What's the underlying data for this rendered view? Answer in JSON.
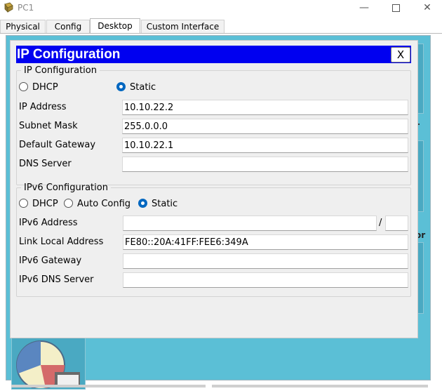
{
  "window": {
    "title": "PC1"
  },
  "tabs": [
    {
      "label": "Physical"
    },
    {
      "label": "Config"
    },
    {
      "label": "Desktop"
    },
    {
      "label": "Custom Interface"
    }
  ],
  "active_tab": "Desktop",
  "desktop": {
    "side_text_1": "r",
    "side_text_2": "or"
  },
  "dialog": {
    "title": "IP Configuration",
    "close_label": "X",
    "ipv4": {
      "legend": "IP Configuration",
      "mode_options": [
        "DHCP",
        "Static"
      ],
      "selected_mode": "Static",
      "fields": [
        {
          "label": "IP Address",
          "value": "10.10.22.2"
        },
        {
          "label": "Subnet Mask",
          "value": "255.0.0.0"
        },
        {
          "label": "Default Gateway",
          "value": "10.10.22.1"
        },
        {
          "label": "DNS Server",
          "value": ""
        }
      ]
    },
    "ipv6": {
      "legend": "IPv6 Configuration",
      "mode_options": [
        "DHCP",
        "Auto Config",
        "Static"
      ],
      "selected_mode": "Static",
      "address_label": "IPv6 Address",
      "address_value": "",
      "prefix_separator": "/",
      "prefix_value": "",
      "fields": [
        {
          "label": "Link Local Address",
          "value": "FE80::20A:41FF:FEE6:349A"
        },
        {
          "label": "IPv6 Gateway",
          "value": ""
        },
        {
          "label": "IPv6 DNS Server",
          "value": ""
        }
      ]
    }
  },
  "colors": {
    "dialog_header": "#0000f0",
    "desktop_bg": "#5bbfd6",
    "radio_selected": "#0067c0"
  }
}
